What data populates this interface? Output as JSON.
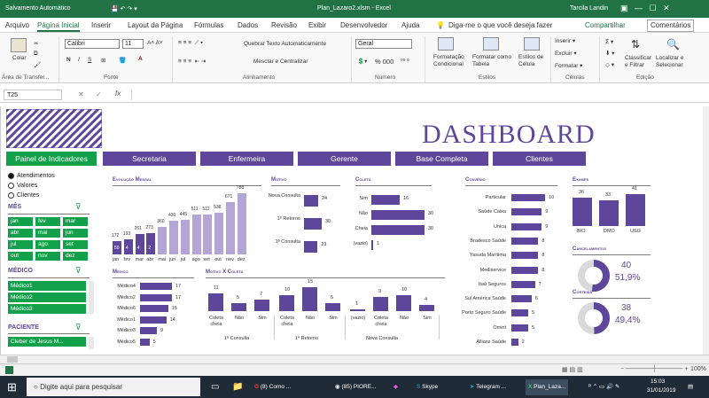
{
  "titlebar": {
    "autosave": "Salvamento Automático",
    "filename": "Plan_Lazaro2.xlsm - Excel",
    "user": "Tarcila Landin"
  },
  "tabs": [
    "Arquivo",
    "Página Inicial",
    "Inserir",
    "Layout da Página",
    "Fórmulas",
    "Dados",
    "Revisão",
    "Exibir",
    "Desenvolvedor",
    "Ajuda"
  ],
  "tellme": "Diga-me o que você deseja fazer",
  "share": "Compartilhar",
  "comments": "Comentários",
  "ribbon": {
    "paste": "Colar",
    "font_name": "Calibri",
    "font_size": "11",
    "wrap": "Quebrar Texto Automaticamente",
    "merge": "Mesclar e Centralizar",
    "number_format": "Geral",
    "percent": "% 000",
    "cond_format": "Formatação Condicional",
    "format_table": "Formatar como Tabela",
    "cell_styles": "Estilos de Célula",
    "insert": "Inserir",
    "delete": "Excluir",
    "format": "Formatar",
    "sort": "Classificar e Filtrar",
    "find": "Localizar e Selecionar",
    "groups": [
      "Área de Transfer...",
      "Fonte",
      "Alinhamento",
      "Número",
      "Estilos",
      "Células",
      "Edição"
    ]
  },
  "formula": {
    "namebox": "T25",
    "fx": "fx"
  },
  "dashboard": {
    "title": "DASHBOARD",
    "panel_label": "Painel de Indicadores",
    "nav": [
      "Secretaria",
      "Enfermeira",
      "Gerente",
      "Base Completa",
      "Clientes"
    ]
  },
  "options": {
    "items": [
      "Atendimentos",
      "Valores",
      "Clientes"
    ],
    "selected": 0
  },
  "mes": {
    "label": "MÊS",
    "items": [
      "jan",
      "fev",
      "mar",
      "abr",
      "mai",
      "jun",
      "jul",
      "ago",
      "set",
      "out",
      "nov",
      "dez"
    ]
  },
  "medico_filter": {
    "label": "MÉDICO",
    "items": [
      "Médico1",
      "Médico2",
      "Médico3"
    ]
  },
  "paciente": {
    "label": "PACIENTE",
    "value": "Cleber de Jesus M..."
  },
  "sections": {
    "evolucao": "Evolução Mensal",
    "motivo": "Motivo",
    "coleta": "Coleta",
    "convenio": "Convênio",
    "exames": "Exames",
    "medico": "Médico",
    "motivo_coleta": "Motivo X Coleta",
    "cancelamentos": "Cancelamentos",
    "cortesia": "Cortesia"
  },
  "chart_data": [
    {
      "type": "bar",
      "title": "Evolução Mensal",
      "categories": [
        "jan",
        "fev",
        "mar",
        "abr",
        "mai",
        "jun",
        "jul",
        "ago",
        "set",
        "out",
        "nov",
        "dez"
      ],
      "values": [
        172,
        193,
        261,
        273,
        360,
        430,
        445,
        511,
        511,
        538,
        671,
        788
      ],
      "inner_labels": [
        "50",
        "4",
        "4",
        "2",
        "",
        "",
        "",
        "",
        "",
        "",
        "",
        ""
      ]
    },
    {
      "type": "bar",
      "title": "Motivo",
      "categories": [
        "Nova Consulta",
        "1º Retorno",
        "1ª Consulta"
      ],
      "values": [
        24,
        30,
        23
      ]
    },
    {
      "type": "bar",
      "title": "Coleta",
      "categories": [
        "Sim",
        "Não",
        "Cheia",
        "(vazio)"
      ],
      "values": [
        16,
        30,
        30,
        1
      ]
    },
    {
      "type": "bar",
      "title": "Convênio",
      "categories": [
        "Particular",
        "Saúde Caixa",
        "Unica",
        "Bradesco Saúde",
        "Yasuda Marítima",
        "Mediservice",
        "Itaú Seguros",
        "Sul América Saúde",
        "Porto Seguro Saúde",
        "Omint",
        "Allianz Saúde"
      ],
      "values": [
        10,
        9,
        9,
        8,
        8,
        8,
        7,
        6,
        5,
        5,
        2
      ]
    },
    {
      "type": "bar",
      "title": "Exames",
      "categories": [
        "BIO",
        "DMO",
        "USG"
      ],
      "values": [
        36,
        33,
        41
      ]
    },
    {
      "type": "bar",
      "title": "Médico",
      "categories": [
        "Médico4",
        "Médico2",
        "Médico6",
        "Médico1",
        "Médico3",
        "Médico5"
      ],
      "values": [
        17,
        17,
        15,
        14,
        9,
        5
      ]
    },
    {
      "type": "bar",
      "title": "Motivo X Coleta",
      "groups": [
        {
          "name": "1ª Consulta",
          "categories": [
            "Coleta cheia",
            "Não",
            "Sim"
          ],
          "values": [
            11,
            5,
            7
          ]
        },
        {
          "name": "1º Retorno",
          "categories": [
            "Coleta cheia",
            "Não",
            "Sim"
          ],
          "values": [
            10,
            15,
            5
          ]
        },
        {
          "name": "Nova Consulta",
          "categories": [
            "(vazio)",
            "Coleta cheia",
            "Não",
            "Sim"
          ],
          "values": [
            1,
            9,
            10,
            4
          ]
        }
      ]
    },
    {
      "type": "pie",
      "title": "Cancelamentos",
      "value": "40",
      "percent": "51,9%",
      "fraction": 0.519
    },
    {
      "type": "pie",
      "title": "Cortesia",
      "value": "38",
      "percent": "49,4%",
      "fraction": 0.494
    }
  ],
  "status": {
    "zoom": "100%"
  },
  "taskbar": {
    "search": "Digite aqui para pesquisar",
    "items": [
      "(8) Como ...",
      "(85) PIORE...",
      "Skype",
      "Telegram ...",
      "Plan_Laza..."
    ],
    "time": "15:03",
    "date": "31/01/2019"
  },
  "colors": {
    "excel_green": "#217346",
    "purple": "#5e479b",
    "green_btn": "#13a04b",
    "light_purple": "#b3a5d6"
  }
}
